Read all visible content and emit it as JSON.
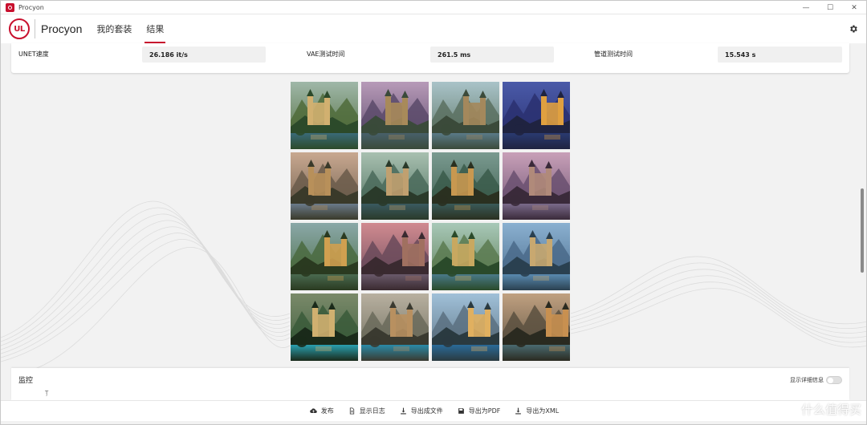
{
  "window": {
    "title": "Procyon",
    "controls": [
      "—",
      "☐",
      "✕"
    ]
  },
  "header": {
    "logo_text": "UL",
    "brand": "Procyon",
    "tabs": [
      {
        "label": "我的套装",
        "active": false
      },
      {
        "label": "结果",
        "active": true
      }
    ],
    "settings_icon": "gear-icon"
  },
  "metrics": {
    "unet_label": "UNET速度",
    "unet_value": "26.186 it/s",
    "vae_label": "VAE测试时间",
    "vae_value": "261.5 ms",
    "pipeline_label": "管道测试时间",
    "pipeline_value": "15.543 s"
  },
  "gallery": {
    "rows": 4,
    "cols": 4,
    "image_subject": "fantasy-castle-landscape"
  },
  "monitor": {
    "title": "监控",
    "subtitle": "Ţ",
    "detail_toggle_label": "显示详细信息",
    "detail_toggle_on": false
  },
  "actions": [
    {
      "label": "发布",
      "icon": "cloud-upload-icon"
    },
    {
      "label": "显示日志",
      "icon": "document-icon"
    },
    {
      "label": "导出成文件",
      "icon": "download-icon"
    },
    {
      "label": "导出为PDF",
      "icon": "save-icon"
    },
    {
      "label": "导出为XML",
      "icon": "download-icon"
    }
  ],
  "watermark": {
    "text": "什么值得买"
  },
  "colors": {
    "brand_red": "#c8102e",
    "background": "#f2f2f2",
    "card": "#ffffff",
    "value_box": "#f0f0f0"
  }
}
